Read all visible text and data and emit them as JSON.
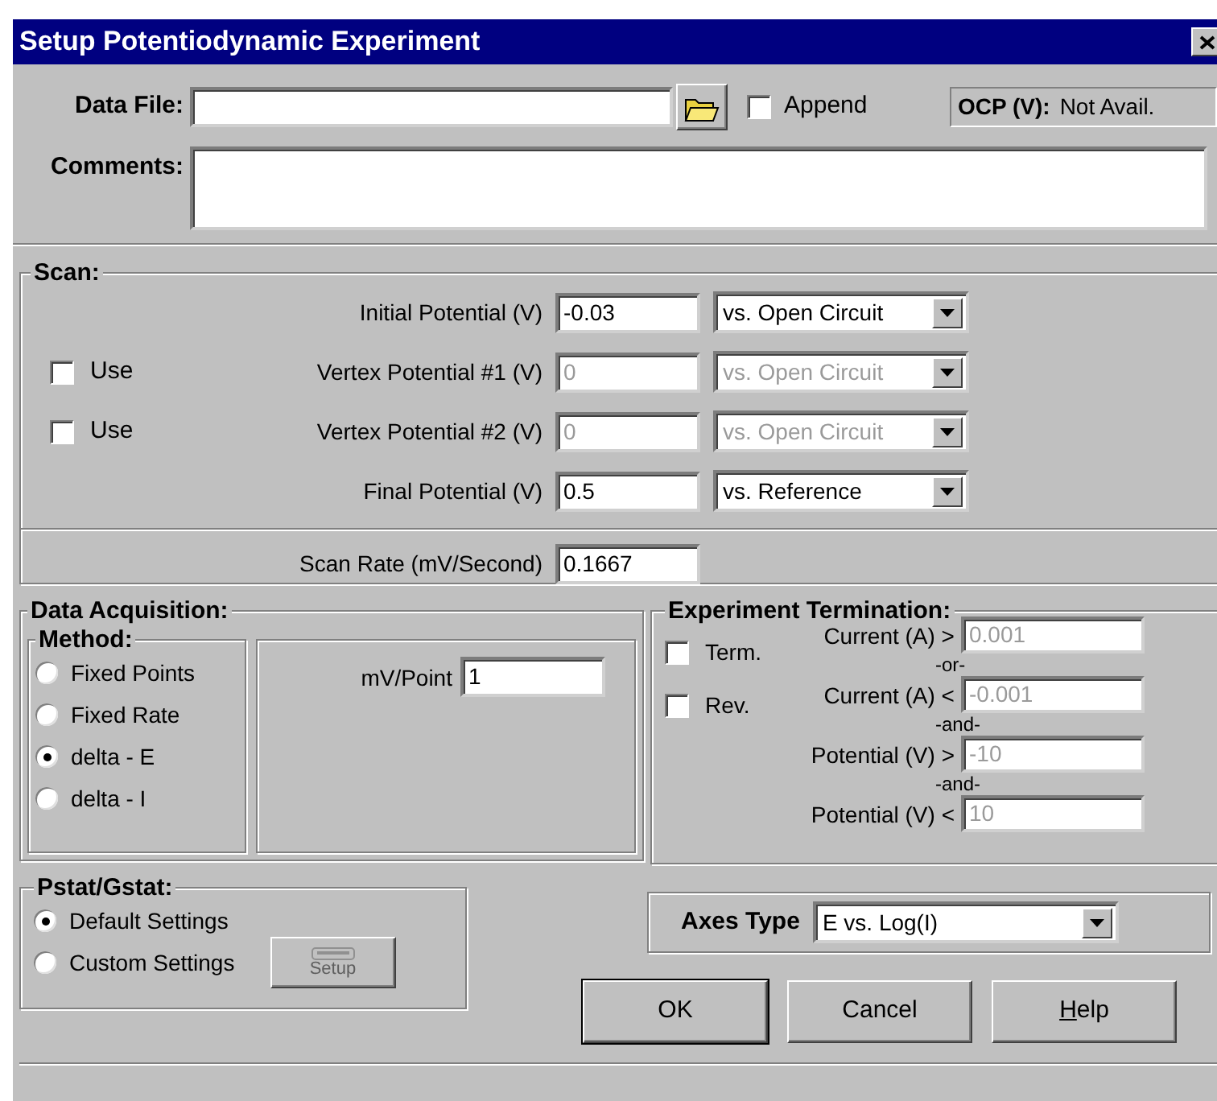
{
  "window": {
    "title": "Setup Potentiodynamic Experiment"
  },
  "data_file": {
    "label": "Data File:"
  },
  "append": {
    "label": "Append",
    "checked": false
  },
  "ocp": {
    "label": "OCP (V):",
    "value": "Not Avail."
  },
  "comments": {
    "label": "Comments:"
  },
  "scan": {
    "title": "Scan:",
    "rows": [
      {
        "label": "Initial Potential (V)",
        "value": "-0.03",
        "reference": "vs. Open Circuit",
        "disabled": false
      },
      {
        "use": {
          "label": "Use",
          "checked": false
        },
        "label": "Vertex Potential #1 (V)",
        "value": "0",
        "reference": "vs. Open Circuit",
        "disabled": true
      },
      {
        "use": {
          "label": "Use",
          "checked": false
        },
        "label": "Vertex Potential #2 (V)",
        "value": "0",
        "reference": "vs. Open Circuit",
        "disabled": true
      },
      {
        "label": "Final Potential (V)",
        "value": "0.5",
        "reference": "vs. Reference",
        "disabled": false
      }
    ],
    "scan_rate": {
      "label": "Scan Rate (mV/Second)",
      "value": "0.1667"
    }
  },
  "data_acquisition": {
    "title": "Data Acquisition:",
    "method": {
      "title": "Method:",
      "options": [
        {
          "label": "Fixed Points",
          "selected": false
        },
        {
          "label": "Fixed Rate",
          "selected": false
        },
        {
          "label": "delta - E",
          "selected": true
        },
        {
          "label": "delta - I",
          "selected": false
        }
      ]
    },
    "mv_per_point": {
      "label": "mV/Point",
      "value": "1"
    }
  },
  "termination": {
    "title": "Experiment Termination:",
    "checks": [
      {
        "label": "Term.",
        "checked": false
      },
      {
        "label": "Rev.",
        "checked": false
      }
    ],
    "items": [
      {
        "kind": "field",
        "label": "Current (A) >",
        "value": "0.001",
        "disabled": true
      },
      {
        "kind": "connector",
        "text": "-or-"
      },
      {
        "kind": "field",
        "label": "Current (A) <",
        "value": "-0.001",
        "disabled": true
      },
      {
        "kind": "connector",
        "text": "-and-"
      },
      {
        "kind": "field",
        "label": "Potential (V) >",
        "value": "-10",
        "disabled": true
      },
      {
        "kind": "connector",
        "text": "-and-"
      },
      {
        "kind": "field",
        "label": "Potential (V) <",
        "value": "10",
        "disabled": true
      }
    ]
  },
  "pstat": {
    "title": "Pstat/Gstat:",
    "options": [
      {
        "label": "Default Settings",
        "selected": true
      },
      {
        "label": "Custom Settings",
        "selected": false
      }
    ],
    "setup_button": {
      "label": "Setup",
      "disabled": true
    }
  },
  "axes": {
    "label": "Axes Type",
    "value": "E vs. Log(I)"
  },
  "buttons": [
    {
      "label": "OK",
      "default": true,
      "first_letter_underlined": false
    },
    {
      "label": "Cancel",
      "default": false,
      "first_letter_underlined": false
    },
    {
      "label": "Help",
      "default": false,
      "first_letter_underlined": true
    }
  ]
}
